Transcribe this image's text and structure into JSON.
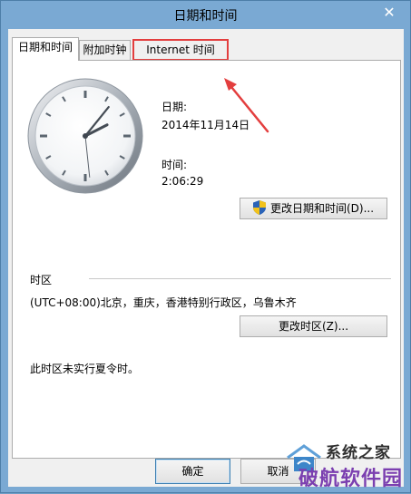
{
  "window": {
    "title": "日期和时间",
    "close_glyph": "✕"
  },
  "tabs": [
    {
      "label": "日期和时间",
      "active": true
    },
    {
      "label": "附加时钟",
      "active": false
    },
    {
      "label": "Internet 时间",
      "active": false,
      "highlighted": true
    }
  ],
  "clock": {
    "hour": 2,
    "minute": 6,
    "second": 29
  },
  "date": {
    "label": "日期:",
    "value": "2014年11月14日"
  },
  "time": {
    "label": "时间:",
    "value": "2:06:29"
  },
  "change_datetime_button": {
    "label": "更改日期和时间(D)...",
    "icon": "uac-shield-icon"
  },
  "timezone": {
    "section_label": "时区",
    "value": "(UTC+08:00)北京，重庆，香港特别行政区，乌鲁木齐",
    "change_button": "更改时区(Z)..."
  },
  "dst_note": "此时区未实行夏令时。",
  "footer": {
    "ok_label": "确定",
    "cancel_label": "取消"
  },
  "watermark": {
    "line1": "系统之家",
    "line2": "破航软件园"
  },
  "colors": {
    "titlebar": "#7aa9d3",
    "highlight": "#e33e3e"
  }
}
